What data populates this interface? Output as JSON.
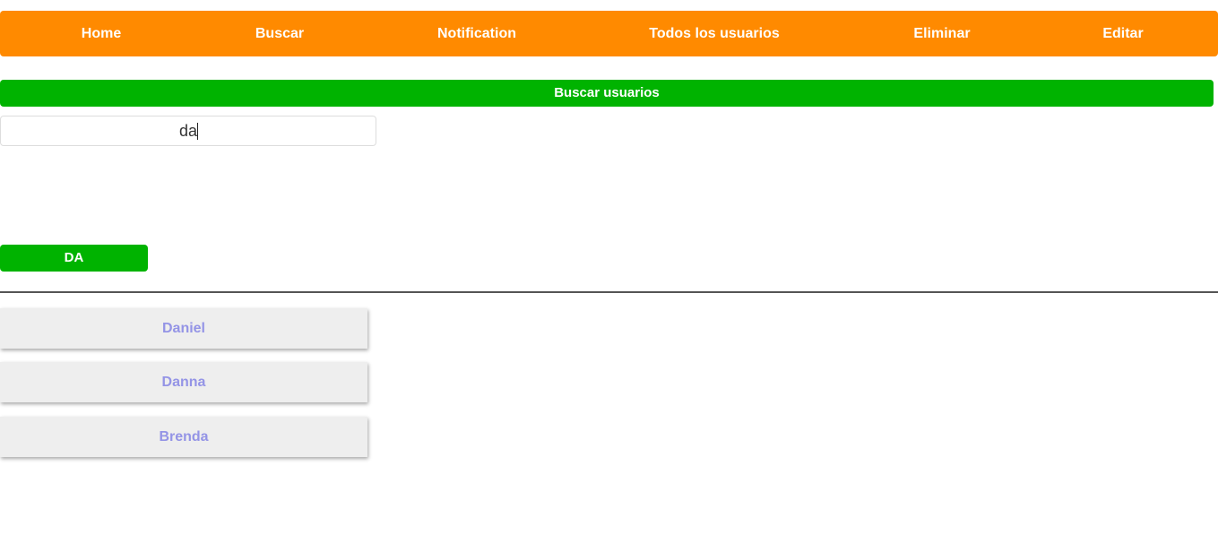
{
  "nav": {
    "items": [
      {
        "label": "Home"
      },
      {
        "label": "Buscar"
      },
      {
        "label": "Notification"
      },
      {
        "label": "Todos los usuarios"
      },
      {
        "label": "Eliminar"
      },
      {
        "label": "Editar"
      }
    ]
  },
  "search": {
    "header": "Buscar usuarios",
    "value": "da",
    "tag": "DA"
  },
  "results": [
    {
      "name": "Daniel"
    },
    {
      "name": "Danna"
    },
    {
      "name": "Brenda"
    }
  ],
  "colors": {
    "navbar": "#ff8a00",
    "accent_green": "#00b300",
    "result_text": "#9494e6",
    "result_bg": "#eeeeee"
  }
}
